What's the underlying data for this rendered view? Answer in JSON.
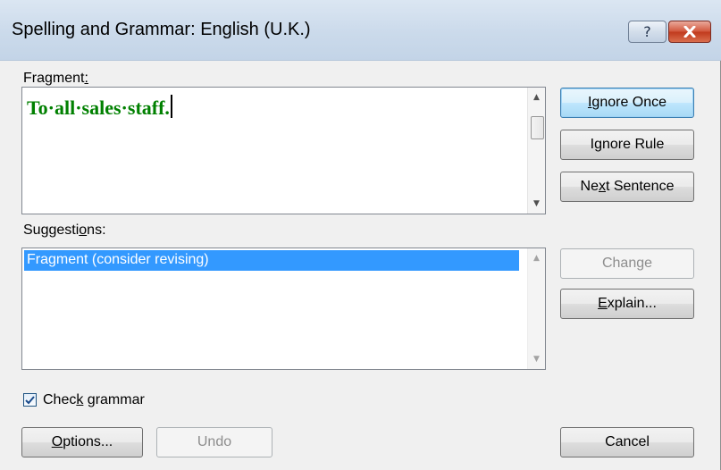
{
  "window": {
    "title": "Spelling and Grammar: English (U.K.)",
    "help_glyph": "?",
    "close_icon": "close-icon"
  },
  "fragment": {
    "label_pre": "Fragment",
    "label_mnemonic": ":",
    "text": "To·all·sales·staff."
  },
  "suggestions": {
    "label_pre": "Suggesti",
    "label_mnemonic": "o",
    "label_post": "ns:",
    "items": [
      "Fragment (consider revising)"
    ],
    "selected_index": 0
  },
  "buttons": {
    "ignore_once": {
      "mnemonic": "I",
      "rest": "gnore Once"
    },
    "ignore_rule": {
      "pre": "I",
      "mnemonic": "g",
      "rest": "nore Rule"
    },
    "next_sentence": {
      "pre": "Ne",
      "mnemonic": "x",
      "rest": "t Sentence"
    },
    "change": "Change",
    "explain": {
      "mnemonic": "E",
      "rest": "xplain..."
    },
    "options": {
      "mnemonic": "O",
      "rest": "ptions..."
    },
    "undo": "Undo",
    "cancel": "Cancel"
  },
  "check_grammar": {
    "checked": true,
    "label_pre": "Chec",
    "label_mnemonic": "k",
    "label_post": " grammar"
  },
  "colors": {
    "fragment_text": "#008000",
    "selection": "#3399ff"
  }
}
